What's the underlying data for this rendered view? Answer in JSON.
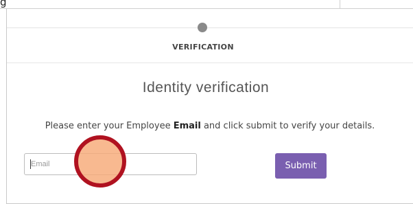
{
  "top_bar": {
    "label": "g"
  },
  "step": {
    "label": "VERIFICATION"
  },
  "main": {
    "title": "Identity verification",
    "instruction_before": "Please enter your Employee ",
    "instruction_bold": "Email",
    "instruction_after": " and click submit to verify your details."
  },
  "form": {
    "email_placeholder": "Email",
    "email_value": "",
    "submit_label": "Submit"
  },
  "colors": {
    "accent": "#7a5fb0",
    "marker_ring": "#b01220",
    "marker_fill": "#f6aa78"
  }
}
